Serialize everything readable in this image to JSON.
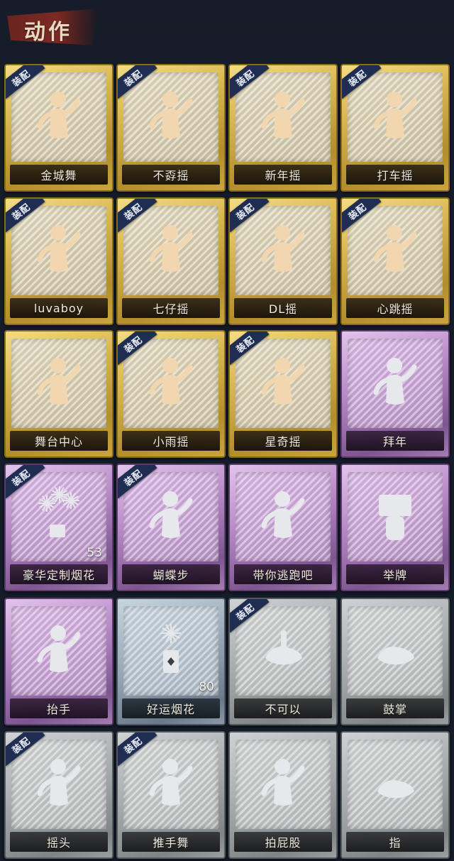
{
  "header": {
    "title": "动作"
  },
  "equipped_label": "装配",
  "colors": {
    "gold": "#d7b64f",
    "purple": "#b78ac7",
    "blue": "#98a8b6",
    "gray": "#a6abad",
    "ribbon": "#1f2d52",
    "figure_gold": "#f1d6b0",
    "figure_light": "#e6e8ec"
  },
  "cards": [
    {
      "label": "金城舞",
      "rarity": "gold",
      "equipped": true,
      "icon": "dance-figure-icon"
    },
    {
      "label": "不孬摇",
      "rarity": "gold",
      "equipped": true,
      "icon": "dance-figure-icon"
    },
    {
      "label": "新年摇",
      "rarity": "gold",
      "equipped": true,
      "icon": "dance-figure-icon"
    },
    {
      "label": "打车摇",
      "rarity": "gold",
      "equipped": true,
      "icon": "dance-figure-icon"
    },
    {
      "label": "luvaboy",
      "rarity": "gold",
      "equipped": true,
      "icon": "dance-figure-icon"
    },
    {
      "label": "七仔摇",
      "rarity": "gold",
      "equipped": true,
      "icon": "dance-figure-icon"
    },
    {
      "label": "DL摇",
      "rarity": "gold",
      "equipped": true,
      "icon": "dance-figure-icon"
    },
    {
      "label": "心跳摇",
      "rarity": "gold",
      "equipped": true,
      "icon": "dance-figure-icon"
    },
    {
      "label": "舞台中心",
      "rarity": "gold",
      "equipped": false,
      "icon": "dance-figure-icon"
    },
    {
      "label": "小雨摇",
      "rarity": "gold",
      "equipped": true,
      "icon": "dance-figure-icon"
    },
    {
      "label": "星奇摇",
      "rarity": "gold",
      "equipped": true,
      "icon": "dance-figure-icon"
    },
    {
      "label": "拜年",
      "rarity": "purple",
      "equipped": false,
      "icon": "bow-figure-icon"
    },
    {
      "label": "豪华定制烟花",
      "rarity": "purple",
      "equipped": true,
      "icon": "fireworks-box-icon",
      "count": "53"
    },
    {
      "label": "蝴蝶步",
      "rarity": "purple",
      "equipped": true,
      "icon": "dance-figure-icon"
    },
    {
      "label": "带你逃跑吧",
      "rarity": "purple",
      "equipped": false,
      "icon": "dance-figure-icon"
    },
    {
      "label": "举牌",
      "rarity": "purple",
      "equipped": false,
      "icon": "sign-figure-icon"
    },
    {
      "label": "抬手",
      "rarity": "purple",
      "equipped": false,
      "icon": "raise-hand-figure-icon"
    },
    {
      "label": "好运烟花",
      "rarity": "blue",
      "equipped": false,
      "icon": "firework-can-icon",
      "count": "80"
    },
    {
      "label": "不可以",
      "rarity": "gray",
      "equipped": true,
      "icon": "finger-wag-icon"
    },
    {
      "label": "鼓掌",
      "rarity": "gray",
      "equipped": false,
      "icon": "clap-hands-icon"
    },
    {
      "label": "摇头",
      "rarity": "gray",
      "equipped": true,
      "icon": "shake-head-figure-icon"
    },
    {
      "label": "推手舞",
      "rarity": "gray",
      "equipped": true,
      "icon": "push-dance-figure-icon"
    },
    {
      "label": "拍屁股",
      "rarity": "gray",
      "equipped": false,
      "icon": "butt-slap-figure-icon"
    },
    {
      "label": "指",
      "rarity": "gray",
      "equipped": false,
      "icon": "point-hand-icon"
    }
  ]
}
